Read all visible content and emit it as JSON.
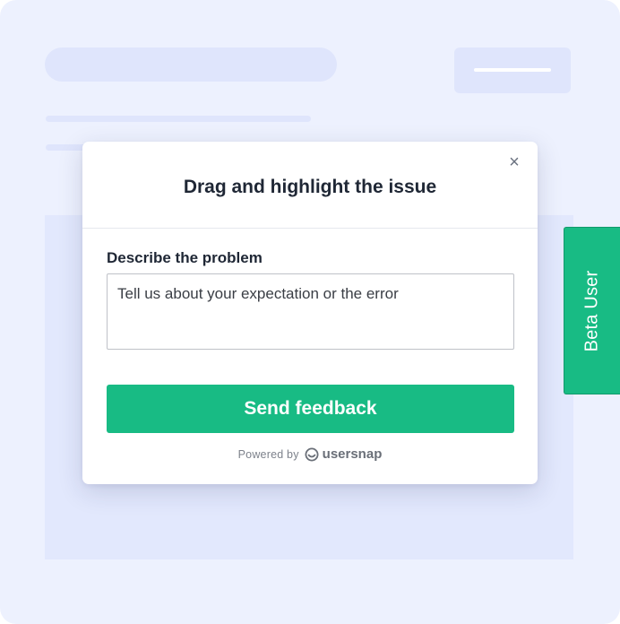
{
  "dialog": {
    "title": "Drag and highlight the issue",
    "close_icon": "×",
    "field_label": "Describe the problem",
    "input_placeholder": "Tell us about your expectation or the error",
    "input_value": "",
    "submit_label": "Send feedback",
    "powered_by": "Powered by",
    "brand_name": "usersnap",
    "brand_icon": "usersnap-logo-icon"
  },
  "side_tab": {
    "label": "Beta User"
  },
  "colors": {
    "accent": "#18bb84",
    "background": "#edf1fe",
    "placeholder_block": "#dfe5fc",
    "title_text": "#1f2735"
  }
}
